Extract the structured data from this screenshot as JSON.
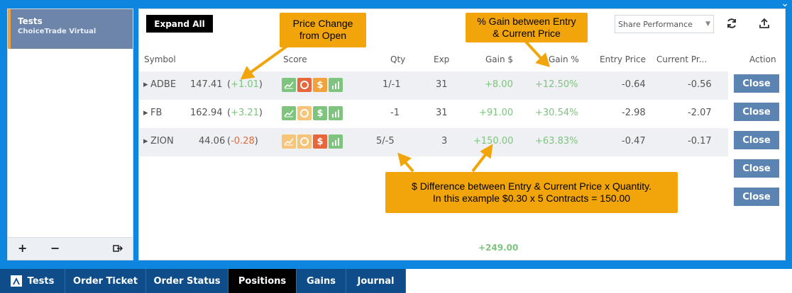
{
  "sidebar": {
    "card": {
      "name": "Tests",
      "broker": "ChoiceTrade Virtual"
    },
    "footer": {
      "add": "+",
      "remove": "−"
    }
  },
  "toolbar": {
    "expand_label": "Expand All",
    "performance_select": "Share Performance"
  },
  "columns": {
    "symbol": "Symbol",
    "score": "Score",
    "qty": "Qty",
    "exp": "Exp",
    "gain_dollar": "Gain $",
    "gain_pct": "Gain %",
    "entry_price": "Entry Price",
    "current_price": "Current Pr...",
    "action": "Action"
  },
  "positions": [
    {
      "symbol": "ADBE",
      "price": "147.41",
      "change": "+1.01",
      "qty": "1/-1",
      "exp": "31",
      "gain_dollar": "+8.00",
      "gain_pct": "+12.50%",
      "entry_price": "-0.64",
      "current_price": "-0.56"
    },
    {
      "symbol": "FB",
      "price": "162.94",
      "change": "+3.21",
      "qty": "-1",
      "exp": "31",
      "gain_dollar": "+91.00",
      "gain_pct": "+30.54%",
      "entry_price": "-2.98",
      "current_price": "-2.07"
    },
    {
      "symbol": "ZION",
      "price": "44.06",
      "change": "-0.28",
      "qty": "5/-5",
      "exp": "3",
      "gain_dollar": "+150.00",
      "gain_pct": "+63.83%",
      "entry_price": "-0.47",
      "current_price": "-0.17"
    }
  ],
  "action_buttons": [
    "Close",
    "Close",
    "Close",
    "Close",
    "Close"
  ],
  "total_gain": "+249.00",
  "callouts": {
    "price_change": {
      "line1": "Price Change",
      "line2": "from Open"
    },
    "gain_pct": {
      "line1": "% Gain between Entry",
      "line2": "& Current Price"
    },
    "difference": {
      "line1": "$ Difference between Entry & Current Price x Quantity.",
      "line2": "In this example $0.30 x 5 Contracts = 150.00"
    }
  },
  "tabs": [
    {
      "label": "Tests",
      "active": false
    },
    {
      "label": "Order Ticket",
      "active": false
    },
    {
      "label": "Order Status",
      "active": false
    },
    {
      "label": "Positions",
      "active": true
    },
    {
      "label": "Gains",
      "active": false
    },
    {
      "label": "Journal",
      "active": false
    }
  ],
  "colors": {
    "accent": "#f2a50a",
    "gain_green": "#7ec47e",
    "loss_red": "#e26a3b",
    "close_button": "#5b84b2",
    "tab_bar": "#0f4d8a"
  }
}
